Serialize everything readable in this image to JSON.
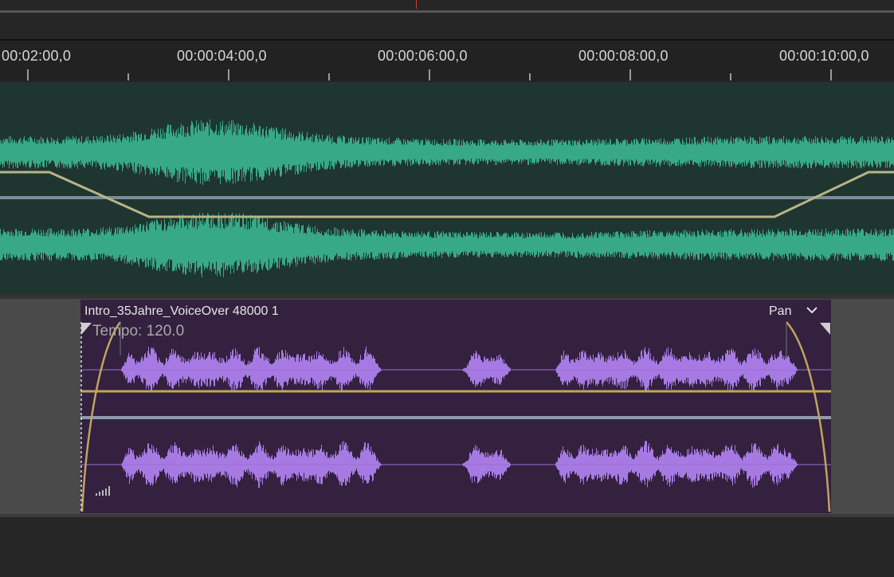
{
  "ruler": {
    "labels": [
      "00:02:00,0",
      "00:00:04:00,0",
      "00:00:06:00,0",
      "00:00:08:00,0",
      "00:00:10:00,0"
    ]
  },
  "track1": {
    "waveform_color": "#37a985",
    "background_color": "#1f3530",
    "automation_color": "#b8b585"
  },
  "clip": {
    "title": "Intro_35Jahre_VoiceOver 48000 1",
    "tempo_label": "Tempo: 120.0",
    "pan_label": "Pan",
    "waveform_color": "#a77ae3",
    "background_color": "#33213f",
    "icons": [
      "chevron-down-icon",
      "signal-bars-icon",
      "fade-in-handle-icon",
      "fade-out-handle-icon"
    ]
  },
  "colors": {
    "playhead": "#e0323a",
    "fade_curve": "#c2a35e",
    "center_line": "#8d9cae"
  }
}
